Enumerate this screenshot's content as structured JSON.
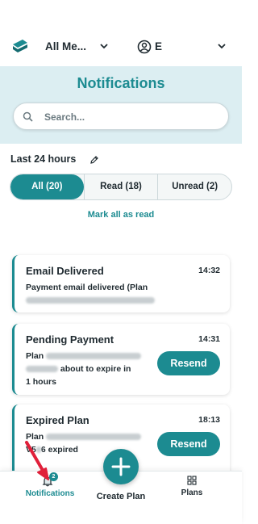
{
  "header": {
    "member_selector": "All Me...",
    "user_initial": "E"
  },
  "page": {
    "title": "Notifications",
    "search_placeholder": "Search..."
  },
  "period": {
    "label": "Last 24 hours"
  },
  "filters": {
    "tabs": [
      {
        "label": "All (20)",
        "active": true
      },
      {
        "label": "Read (18)",
        "active": false
      },
      {
        "label": "Unread (2)",
        "active": false
      }
    ],
    "mark_all_read": "Mark all as read"
  },
  "notifications": [
    {
      "title": "Email Delivered",
      "time": "14:32",
      "line1": "Payment email delivered (Plan"
    },
    {
      "title": "Pending Payment",
      "time": "14:31",
      "plan_prefix": "Plan",
      "line2": "about to expire in",
      "line3": "1 hours",
      "action": "Resend"
    },
    {
      "title": "Expired Plan",
      "time": "18:13",
      "plan_prefix": "Plan",
      "line2": "V5",
      "line2b": "6 expired",
      "action": "Resend"
    }
  ],
  "bottom_nav": {
    "notifications_label": "Notifications",
    "notifications_badge": "2",
    "create_label": "Create Plan",
    "plans_label": "Plans"
  },
  "colors": {
    "accent": "#1c8b91",
    "hero_bg": "#dceef2",
    "annotation_arrow": "#e0203a"
  },
  "icons": [
    "app-logo-icon",
    "chevron-down-icon",
    "user-circle-icon",
    "search-icon",
    "pencil-icon",
    "bell-icon",
    "plus-icon",
    "grid-icon"
  ]
}
